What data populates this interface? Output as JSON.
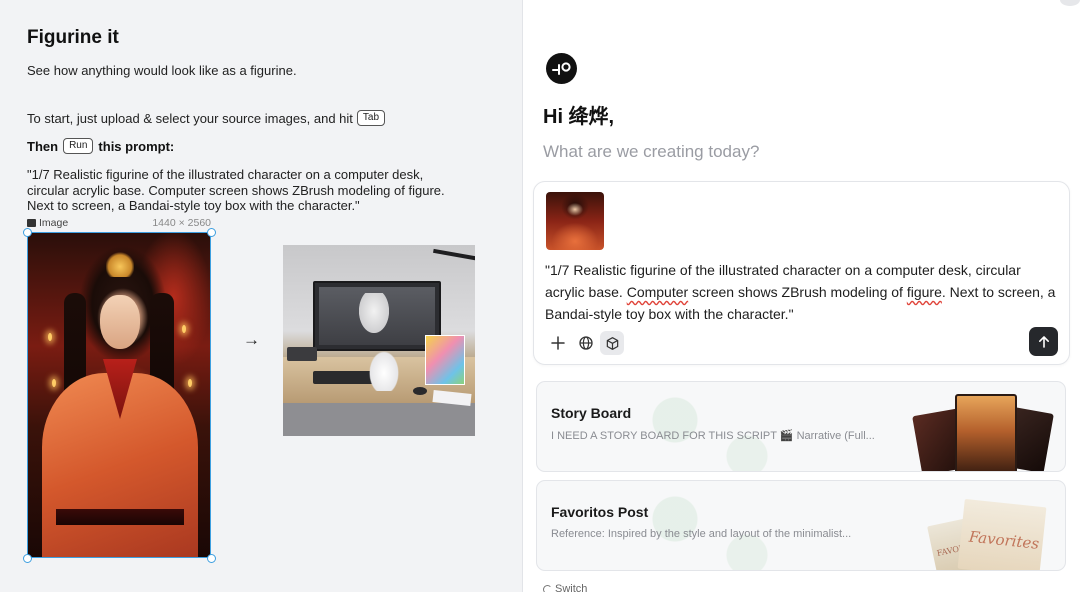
{
  "left": {
    "title": "Figurine it",
    "subtitle": "See how anything would look like as a figurine.",
    "start_text": "To start, just upload & select your source images, and hit",
    "tab_key": "Tab",
    "then_prefix": "Then",
    "run_key": "Run",
    "then_suffix": "this prompt:",
    "prompt": "\"1/7 Realistic figurine of the illustrated character on a computer desk, circular acrylic base. Computer screen shows ZBrush modeling of figure. Next to screen, a Bandai-style toy box with the character.\"",
    "image_label": "Image",
    "image_dimensions": "1440 × 2560",
    "arrow": "→"
  },
  "right": {
    "greeting": "Hi 绛烨,",
    "question": "What are we creating today?",
    "composer": {
      "text_before_1": "\"1/7 Realistic figurine of the illustrated character on a computer desk, circular acrylic base. ",
      "word_1": "Computer",
      "text_between": " screen shows ZBrush modeling of ",
      "word_2": "figure",
      "text_after": ". Next to screen, a Bandai-style toy box with the character.\""
    },
    "cards": [
      {
        "title": "Story Board",
        "description": "I NEED A STORY BOARD FOR THIS SCRIPT 🎬 Narrative (Full..."
      },
      {
        "title": "Favoritos Post",
        "description": "Reference: Inspired by the style and layout of the minimalist..."
      }
    ],
    "fav_cover_word": "Favorites",
    "fav_cover_word_small": "FAVORI",
    "switch_label": "Switch"
  },
  "icons": {
    "logo": "logo-icon",
    "plus": "plus-icon",
    "globe": "globe-icon",
    "cube": "cube-icon",
    "send": "arrow-up-icon",
    "switch": "refresh-icon",
    "image": "image-icon"
  },
  "colors": {
    "selection": "#3d9fe0",
    "send_button": "#26282c",
    "spellcheck": "#e0443a",
    "muted_text": "#9a9ca3"
  }
}
